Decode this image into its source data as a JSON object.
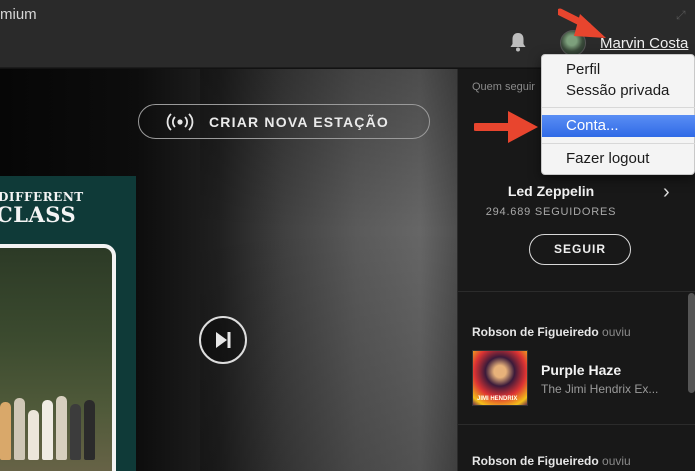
{
  "topbar": {
    "premium_fragment_top": "...",
    "premium_fragment": "mium",
    "username": "Marvin Costa"
  },
  "main": {
    "station_button_label": "CRIAR NOVA ESTAÇÃO",
    "album_title_line1": "DIFFERENT",
    "album_title_line2": "CLASS"
  },
  "rightpanel": {
    "heading": "Quem seguir",
    "artist": {
      "name": "Led Zeppelin",
      "followers": "294.689 SEGUIDORES",
      "follow_button": "SEGUIR"
    },
    "activity": [
      {
        "user": "Robson de Figueiredo",
        "verb": "ouviu",
        "track": "Purple Haze",
        "artist": "The Jimi Hendrix Ex..."
      },
      {
        "user": "Robson de Figueiredo",
        "verb": "ouviu"
      }
    ]
  },
  "menu": {
    "items": [
      "Perfil",
      "Sessão privada",
      "Conta...",
      "Fazer logout"
    ],
    "highlighted": "Conta..."
  },
  "colors": {
    "accent_highlight": "#3a74ea",
    "annotation_arrow": "#e8452e",
    "panel_bg": "#181818",
    "topbar_bg": "#2a2a2a"
  },
  "icons": {
    "bell": "bell-icon",
    "station": "radio-broadcast-icon",
    "skip": "skip-forward-icon",
    "chevron": "chevron-right-icon",
    "resize": "resize-icon"
  }
}
